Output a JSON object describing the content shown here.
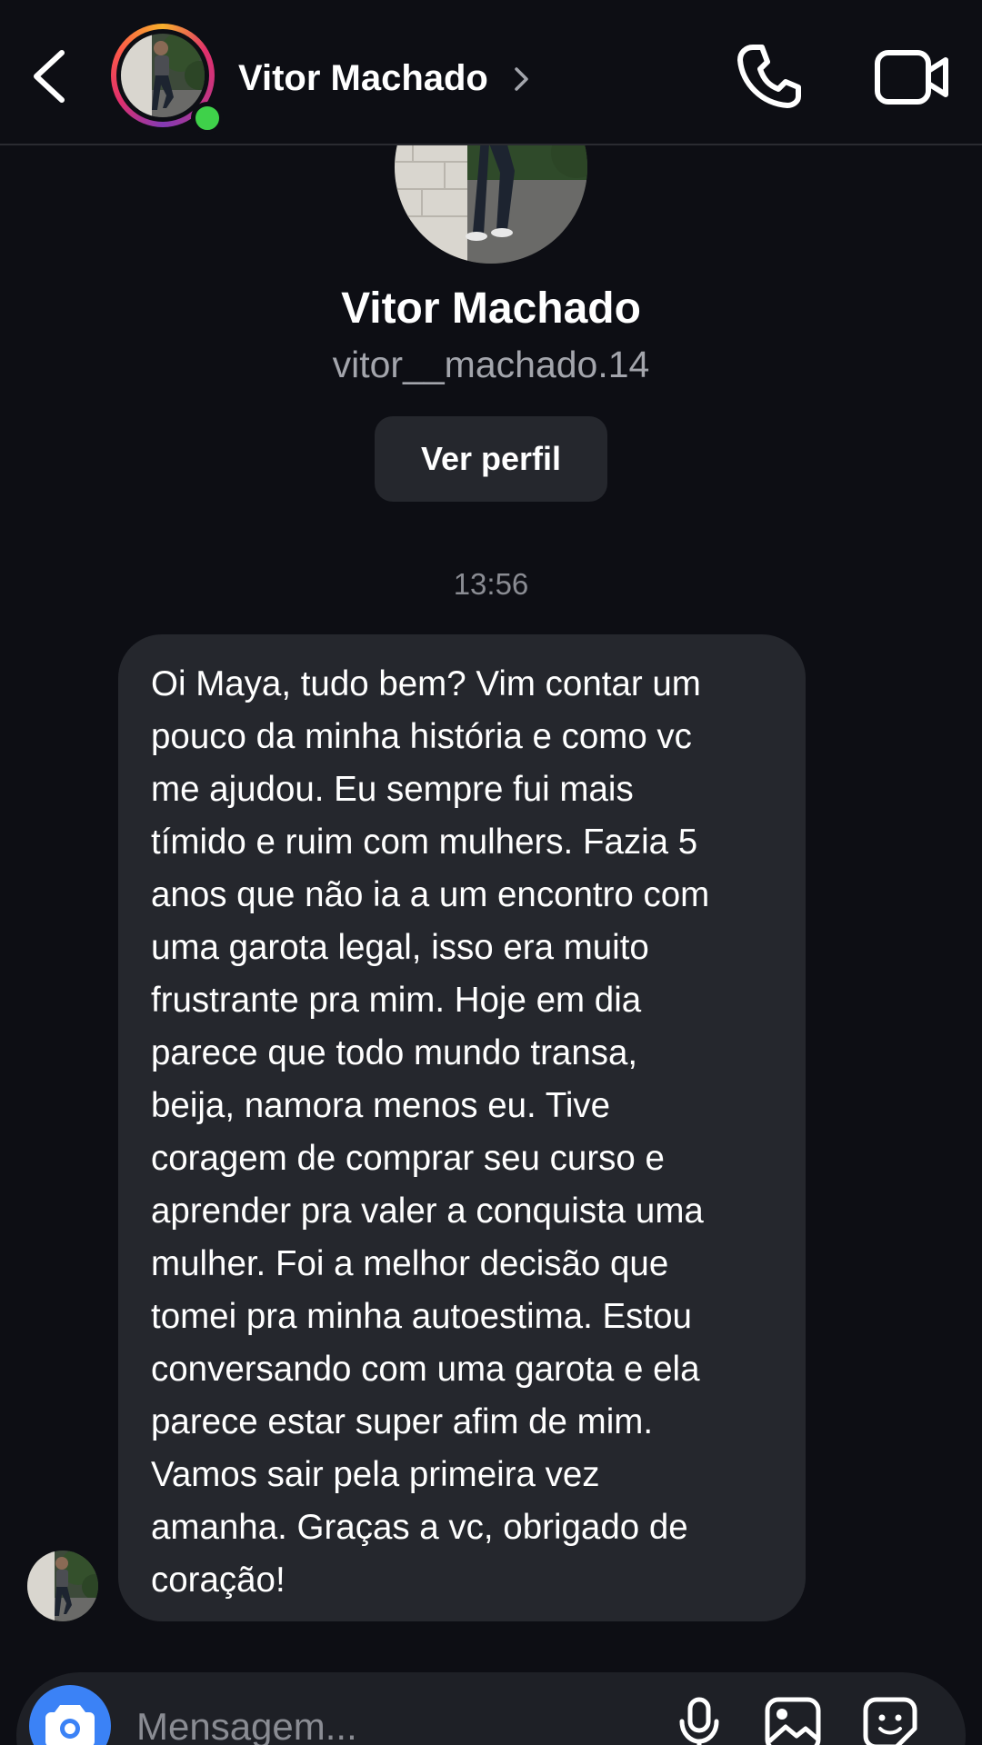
{
  "header": {
    "contact_name": "Vitor Machado",
    "online": true
  },
  "profile": {
    "name": "Vitor Machado",
    "username": "vitor__machado.14",
    "view_profile_label": "Ver perfil"
  },
  "conversation": {
    "timestamp": "13:56",
    "messages": [
      {
        "sender": "Vitor Machado",
        "direction": "incoming",
        "lines": [
          "Oi Maya, tudo bem? Vim contar um",
          "pouco da minha história e como vc",
          "me ajudou. Eu sempre fui mais",
          "tímido e ruim com mulhers. Fazia 5",
          "anos que não ia a um encontro com",
          "uma garota legal, isso era muito",
          "frustrante pra mim. Hoje em dia",
          "parece que todo mundo transa,",
          "beija, namora menos eu. Tive",
          "coragem de comprar seu curso e",
          "aprender pra valer a conquista uma",
          "mulher. Foi a melhor decisão que",
          "tomei pra minha autoestima. Estou",
          "conversando com uma garota e ela",
          "parece estar super afim de mim.",
          "Vamos sair pela primeira vez",
          "amanha. Graças a vc, obrigado de",
          "coração!"
        ]
      }
    ]
  },
  "composer": {
    "placeholder": "Mensagem..."
  },
  "icons": {
    "back": "chevron-left-icon",
    "call": "phone-icon",
    "video": "video-camera-icon",
    "camera": "camera-icon",
    "mic": "microphone-icon",
    "gallery": "image-icon",
    "sticker": "sticker-icon"
  },
  "colors": {
    "background": "#0d0e14",
    "bubble": "#25272d",
    "online": "#3fd14a",
    "camera_button": "#3b82f6",
    "secondary_text": "#a3a5ac"
  }
}
